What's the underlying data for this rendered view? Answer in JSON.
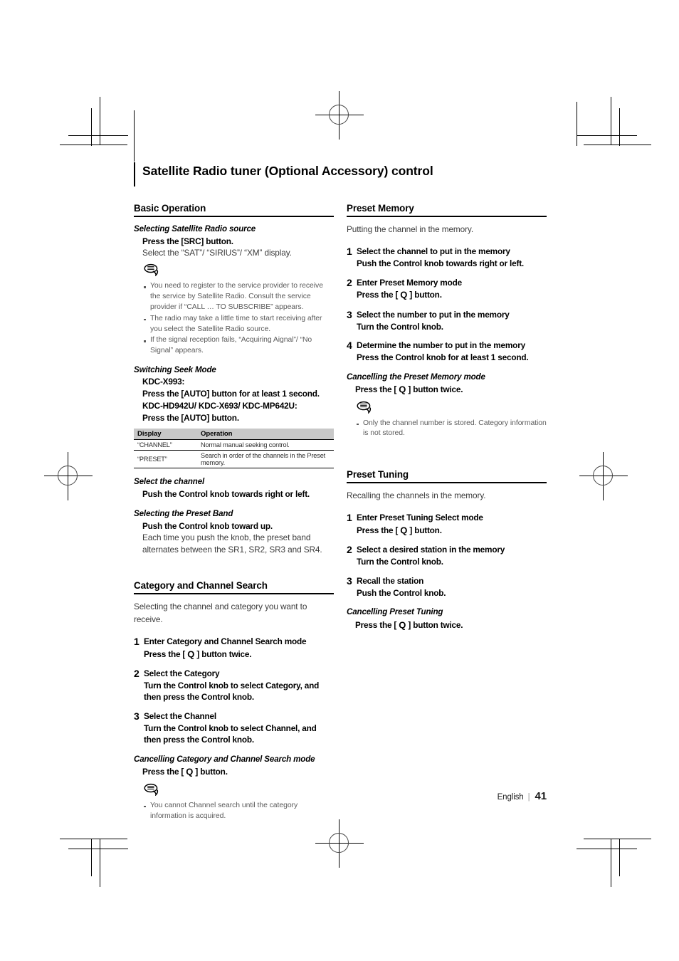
{
  "document": {
    "title": "Satellite Radio tuner (Optional Accessory) control",
    "footer": {
      "language": "English",
      "separator": "|",
      "page_number": "41"
    }
  },
  "left_column": {
    "basic_operation": {
      "heading": "Basic Operation",
      "selecting_source": {
        "sub_heading": "Selecting Satellite Radio source",
        "instruction": "Press the [SRC] button.",
        "detail": "Select the “SAT”/ “SIRIUS”/ “XM” display.",
        "note_icon": "note-bubble-icon",
        "notes": [
          "You need to register to the service provider to receive the service by Satellite Radio. Consult the service provider if “CALL … TO SUBSCRIBE” appears.",
          "The radio may take a little time to start receiving after you select the Satellite Radio source.",
          "If the signal reception fails, “Acquiring Aignal”/ “No Signal” appears."
        ]
      },
      "switching_seek_mode": {
        "sub_heading": "Switching Seek Mode",
        "model_1": "KDC-X993:",
        "instruction_1": "Press the [AUTO] button for at least 1 second.",
        "model_2": "KDC-HD942U/ KDC-X693/ KDC-MP642U:",
        "instruction_2": "Press the [AUTO] button.",
        "table": {
          "headers": [
            "Display",
            "Operation"
          ],
          "rows": [
            [
              "“CHANNEL”",
              "Normal manual seeking control."
            ],
            [
              "“PRESET”",
              "Search in order of the channels in the Preset memory."
            ]
          ]
        }
      },
      "select_channel": {
        "sub_heading": "Select the channel",
        "instruction": "Push the Control knob towards right or left."
      },
      "selecting_preset_band": {
        "sub_heading": "Selecting the Preset Band",
        "instruction": "Push the Control knob toward up.",
        "detail": "Each time you push the knob, the preset band alternates between the SR1, SR2, SR3 and SR4."
      }
    },
    "category_channel_search": {
      "heading": "Category and Channel Search",
      "lead": "Selecting the channel and category you want to receive.",
      "steps": [
        {
          "num": "1",
          "title": "Enter Category and Channel Search mode",
          "detail_before": "Press the [ ",
          "button_glyph": "Q",
          "detail_after": " ] button twice."
        },
        {
          "num": "2",
          "title": "Select the Category",
          "detail": "Turn the Control knob to select Category, and then press the Control knob."
        },
        {
          "num": "3",
          "title": "Select the Channel",
          "detail": "Turn the Control knob to select Channel, and then press the Control knob."
        }
      ],
      "cancelling": {
        "sub_heading": "Cancelling Category and Channel Search mode",
        "detail_before": "Press the [ ",
        "button_glyph": "Q",
        "detail_after": " ] button."
      },
      "note_icon": "note-bubble-icon",
      "notes": [
        "You cannot Channel search until the category information is acquired."
      ]
    }
  },
  "right_column": {
    "preset_memory": {
      "heading": "Preset Memory",
      "lead": "Putting the channel in the memory.",
      "steps": [
        {
          "num": "1",
          "title": "Select the channel to put in the memory",
          "detail": "Push the Control knob towards right or left."
        },
        {
          "num": "2",
          "title": "Enter Preset Memory mode",
          "detail_before": "Press the [ ",
          "button_glyph": "Q",
          "detail_after": " ] button."
        },
        {
          "num": "3",
          "title": "Select the number to put in the memory",
          "detail": "Turn the Control knob."
        },
        {
          "num": "4",
          "title": "Determine the number to put in the memory",
          "detail": "Press the Control knob for at least 1 second."
        }
      ],
      "cancelling": {
        "sub_heading": "Cancelling the Preset Memory mode",
        "detail_before": "Press the [ ",
        "button_glyph": "Q",
        "detail_after": " ] button twice."
      },
      "note_icon": "note-bubble-icon",
      "notes": [
        "Only the channel number is stored. Category information is not stored."
      ]
    },
    "preset_tuning": {
      "heading": "Preset Tuning",
      "lead": "Recalling the channels in the memory.",
      "steps": [
        {
          "num": "1",
          "title": "Enter Preset Tuning Select mode",
          "detail_before": "Press the [ ",
          "button_glyph": "Q",
          "detail_after": " ] button."
        },
        {
          "num": "2",
          "title": "Select a desired station in the memory",
          "detail": "Turn the Control knob."
        },
        {
          "num": "3",
          "title": "Recall the station",
          "detail": "Push the Control knob."
        }
      ],
      "cancelling": {
        "sub_heading": "Cancelling Preset Tuning",
        "detail_before": "Press the [ ",
        "button_glyph": "Q",
        "detail_after": " ] button twice."
      }
    }
  }
}
